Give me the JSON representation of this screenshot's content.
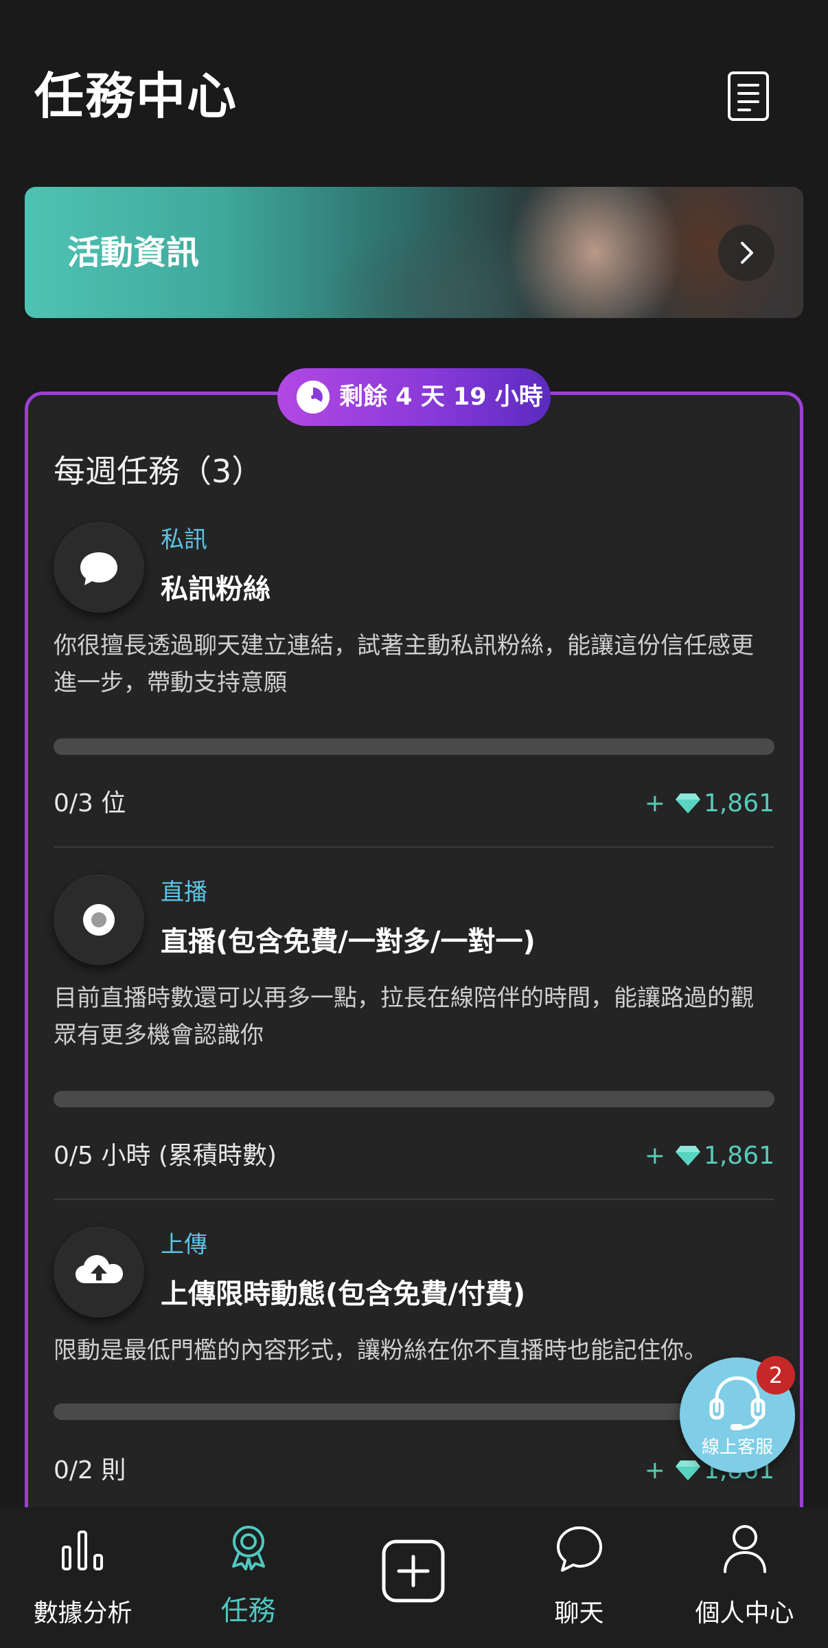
{
  "header": {
    "title": "任務中心",
    "doc_icon": "document-list-icon"
  },
  "banner": {
    "title": "活動資訊",
    "arrow_icon": "chevron-right-icon"
  },
  "weekly": {
    "timer": "剩餘 4 天 19 小時",
    "title": "每週任務（3）",
    "accent_color": "#9b3fd6",
    "tasks": [
      {
        "icon": "chat-bubble-icon",
        "category": "私訊",
        "name": "私訊粉絲",
        "description": "你很擅長透過聊天建立連結，試著主動私訊粉絲，能讓這份信任感更進一步，帶動支持意願",
        "progress_text": "0/3 位",
        "progress_fraction": 0,
        "reward_plus": "+",
        "reward_value": "1,861"
      },
      {
        "icon": "live-record-icon",
        "category": "直播",
        "name": "直播(包含免費/一對多/一對一)",
        "description": "目前直播時數還可以再多一點，拉長在線陪伴的時間，能讓路過的觀眾有更多機會認識你",
        "progress_text": "0/5 小時 (累積時數)",
        "progress_fraction": 0,
        "reward_plus": "+",
        "reward_value": "1,861"
      },
      {
        "icon": "cloud-upload-icon",
        "category": "上傳",
        "name": "上傳限時動態(包含免費/付費)",
        "description": "限動是最低門檻的內容形式，讓粉絲在你不直播時也能記住你。",
        "progress_text": "0/2 則",
        "progress_fraction": 0,
        "reward_plus": "+",
        "reward_value": "1,861"
      }
    ]
  },
  "support": {
    "label": "線上客服",
    "badge": "2"
  },
  "nav": {
    "items": [
      {
        "label": "數據分析",
        "icon": "bar-chart-icon"
      },
      {
        "label": "任務",
        "icon": "award-ribbon-icon"
      },
      {
        "label": "",
        "icon": "plus-square-icon"
      },
      {
        "label": "聊天",
        "icon": "chat-icon"
      },
      {
        "label": "個人中心",
        "icon": "person-icon"
      }
    ],
    "active_index": 1,
    "active_color": "#4fc8c0"
  }
}
